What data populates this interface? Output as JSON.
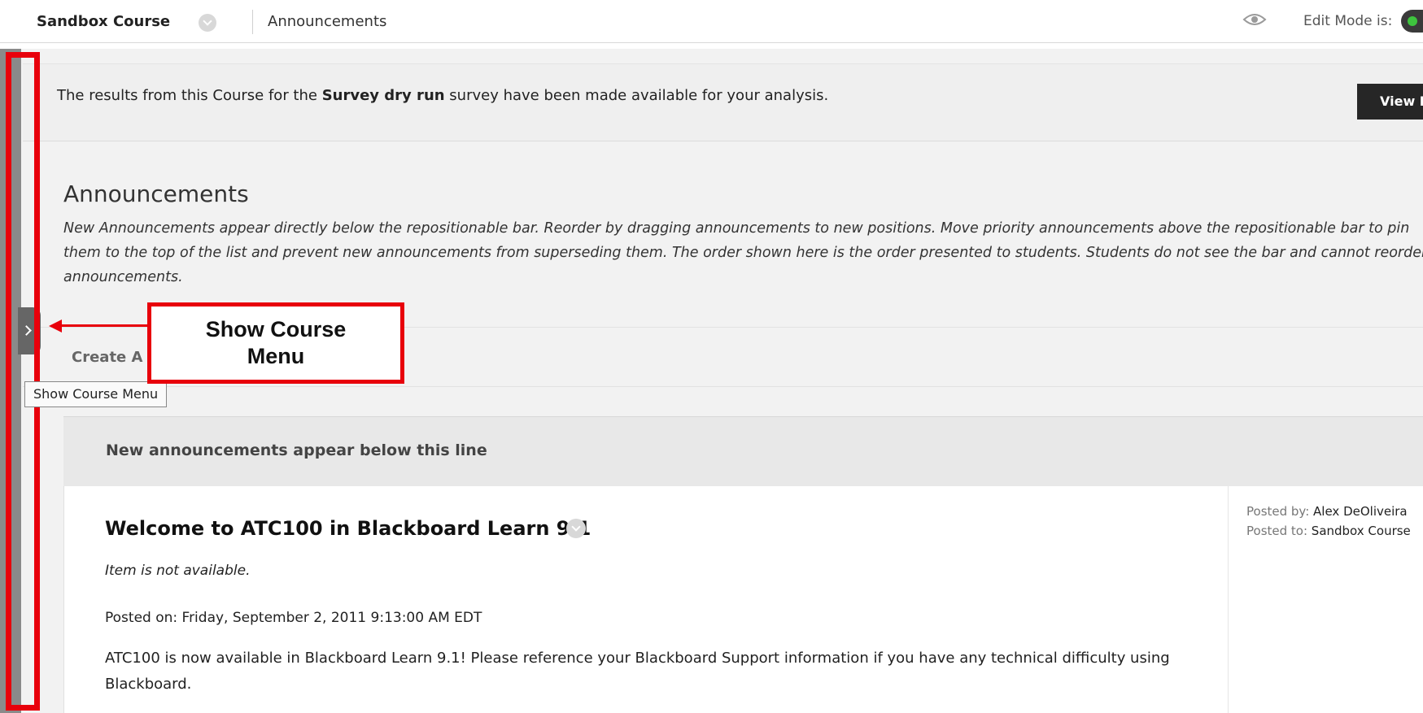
{
  "header": {
    "course_title": "Sandbox Course",
    "breadcrumb": "Announcements",
    "edit_mode_label": "Edit Mode is:"
  },
  "banner": {
    "text_before": "The results from this Course for the ",
    "survey_name": "Survey dry run",
    "text_after": " survey have been made available for your analysis.",
    "view_button": "View Res"
  },
  "page": {
    "title": "Announcements",
    "description": "New Announcements appear directly below the repositionable bar. Reorder by dragging announcements to new positions. Move priority announcements above the repositionable bar to pin them to the top of the list and prevent new announcements from superseding them. The order shown here is the order presented to students. Students do not see the bar and cannot reorder announcements."
  },
  "actions": {
    "create_label": "Create A"
  },
  "course_menu": {
    "tooltip": "Show Course Menu"
  },
  "annotation": {
    "callout_line1": "Show Course",
    "callout_line2": "Menu",
    "color": "#e8000b"
  },
  "repositionable_bar": {
    "text": "New announcements appear below this line"
  },
  "announcement": {
    "title": "Welcome to ATC100 in Blackboard Learn 9.1",
    "availability": "Item is not available.",
    "posted_on": "Posted on: Friday, September 2, 2011 9:13:00 AM EDT",
    "body": "ATC100 is now available in Blackboard Learn 9.1!  Please reference your Blackboard Support information if you have any technical difficulty using Blackboard.",
    "posted_by_label": "Posted by: ",
    "posted_by": "Alex DeOliveira",
    "posted_to_label": "Posted to: ",
    "posted_to": "Sandbox Course"
  }
}
